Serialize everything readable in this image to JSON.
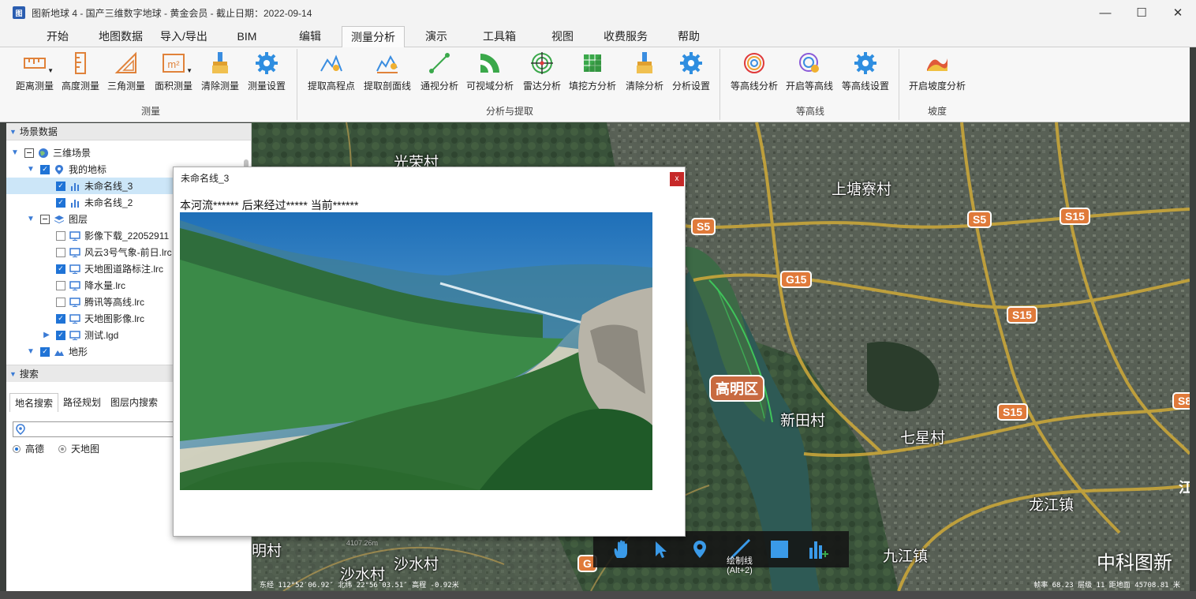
{
  "window": {
    "title": "图新地球 4 - 国产三维数字地球 - 黄金会员 - 截止日期：2022-09-14",
    "app_icon": "图",
    "minimize": "—",
    "maximize": "☐",
    "close": "✕"
  },
  "menu": {
    "tabs": [
      "开始",
      "地图数据",
      "导入/导出",
      "BIM",
      "编辑",
      "测量分析",
      "演示",
      "工具箱",
      "视图",
      "收费服务",
      "帮助"
    ],
    "active": "测量分析"
  },
  "ribbon": {
    "measure": {
      "group": "测量",
      "buttons": [
        "距离测量",
        "高度测量",
        "三角测量",
        "面积测量",
        "清除测量",
        "测量设置"
      ]
    },
    "analysis": {
      "group": "分析与提取",
      "buttons": [
        "提取高程点",
        "提取剖面线",
        "通视分析",
        "可视域分析",
        "雷达分析",
        "填挖方分析",
        "清除分析",
        "分析设置"
      ]
    },
    "contour": {
      "group": "等高线",
      "buttons": [
        "等高线分析",
        "开启等高线",
        "等高线设置"
      ]
    },
    "slope": {
      "group": "坡度",
      "buttons": [
        "开启坡度分析"
      ]
    },
    "area_icon_text": "m²"
  },
  "scene_panel": {
    "header": "场景数据",
    "items": [
      {
        "label": "三维场景"
      },
      {
        "label": "我的地标"
      },
      {
        "label": "未命名线_3"
      },
      {
        "label": "未命名线_2"
      },
      {
        "label": "图层"
      },
      {
        "label": "影像下载_22052911"
      },
      {
        "label": "风云3号气象-前日.lrc"
      },
      {
        "label": "天地图道路标注.lrc"
      },
      {
        "label": "降水量.lrc"
      },
      {
        "label": "腾讯等高线.lrc"
      },
      {
        "label": "天地图影像.lrc"
      },
      {
        "label": "测试.lgd"
      },
      {
        "label": "地形"
      }
    ]
  },
  "search_panel": {
    "header": "搜索",
    "tabs": [
      "地名搜索",
      "路径规划",
      "图层内搜索"
    ],
    "input_value": "",
    "radio": [
      "高德",
      "天地图"
    ]
  },
  "popup": {
    "title": "未命名线_3",
    "close": "x",
    "text": "本河流****** 后来经过***** 当前******"
  },
  "map": {
    "labels": [
      "上塘寮村",
      "新田村",
      "七星村",
      "龙江镇",
      "九江镇",
      "沙水村",
      "明村",
      "光荣村"
    ],
    "district": "高明区",
    "shields": [
      "S5",
      "S5",
      "S15",
      "G15",
      "S15",
      "S15",
      "G",
      "S8",
      "江"
    ],
    "toolbar_tooltip": [
      "绘制线",
      "(Alt+2)"
    ],
    "watermark": "中科图新",
    "faint_label": "4107.26m",
    "status_left": "东经 112°52′06.92″ 北纬 22°56′03.51″  高程 -0.92米",
    "status_right": "帧率 68.23  层级 11  距地面 45708.81 米"
  }
}
